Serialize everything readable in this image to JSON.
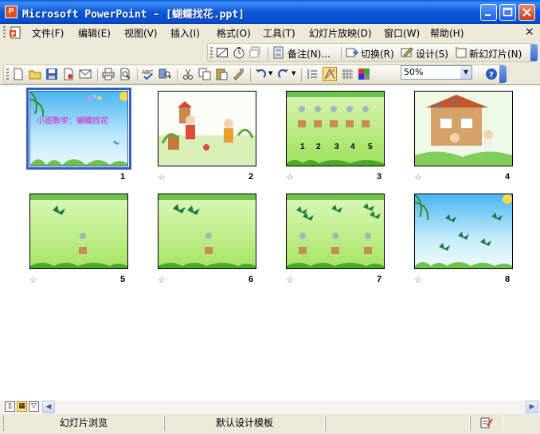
{
  "window": {
    "title": "Microsoft PowerPoint - [蝴蝶找花.ppt]",
    "app_icon": "powerpoint-icon",
    "controls": [
      "minimize-icon",
      "maximize-icon",
      "close-icon"
    ]
  },
  "menubar": {
    "items": [
      {
        "label": "文件(F)"
      },
      {
        "label": "编辑(E)"
      },
      {
        "label": "视图(V)"
      },
      {
        "label": "插入(I)"
      },
      {
        "label": "格式(O)"
      },
      {
        "label": "工具(T)"
      },
      {
        "label": "幻灯片放映(D)"
      },
      {
        "label": "窗口(W)"
      },
      {
        "label": "帮助(H)"
      }
    ],
    "close": "×"
  },
  "toolbar1": {
    "notes_label": "备注(N)...",
    "transition_label": "切换(R)",
    "design_label": "设计(S)",
    "new_slide_label": "新幻灯片(N)"
  },
  "toolbar2": {
    "zoom": "50%"
  },
  "slides": [
    {
      "number": "1",
      "title_text": "小班数学：蝴蝶找花",
      "kind": "title",
      "selected": true
    },
    {
      "number": "2",
      "kind": "kids-garden"
    },
    {
      "number": "3",
      "kind": "pots-numbers",
      "numbers": [
        "1",
        "2",
        "3",
        "4",
        "5"
      ]
    },
    {
      "number": "4",
      "kind": "kids-house"
    },
    {
      "number": "5",
      "kind": "one-butterfly-one-pot"
    },
    {
      "number": "6",
      "kind": "two-butterflies-one-pot"
    },
    {
      "number": "7",
      "kind": "butterflies-three-pots"
    },
    {
      "number": "8",
      "kind": "butterflies-sky"
    }
  ],
  "statusbar": {
    "view_name": "幻灯片浏览",
    "template_name": "默认设计模板"
  },
  "colors": {
    "titlebar": "#0b58d6",
    "selection": "#315fbf",
    "slide_green": "#b8ec7a"
  }
}
